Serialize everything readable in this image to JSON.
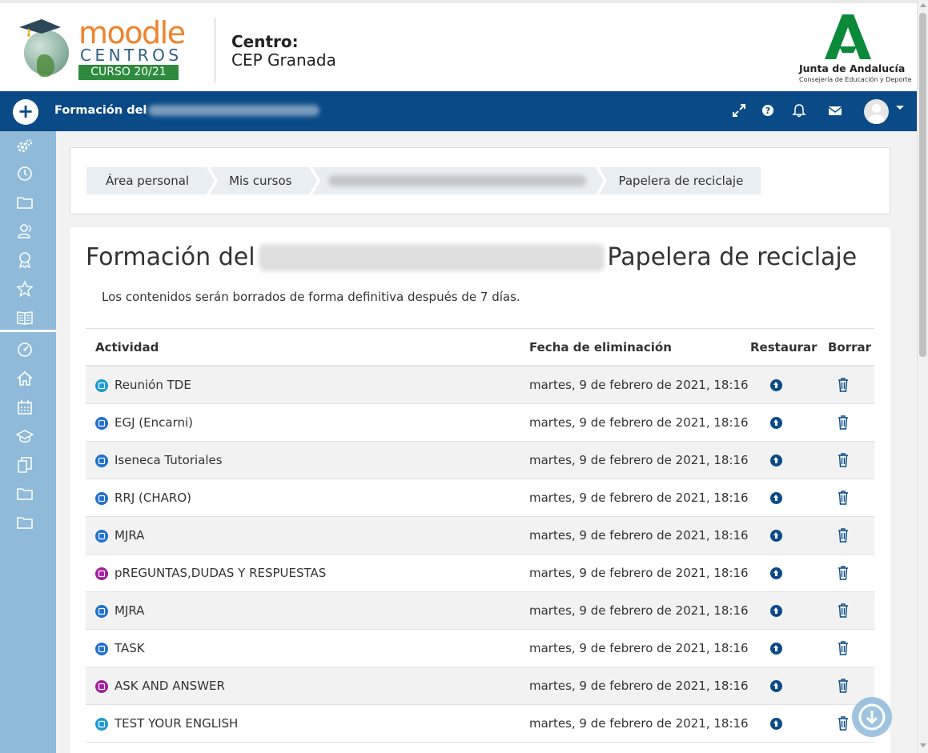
{
  "header": {
    "logo_moodle": "moodle",
    "logo_centros": "CENTROS",
    "logo_curso": "CURSO 20/21",
    "centro_label": "Centro:",
    "centro_name": "CEP Granada",
    "junta_name": "Junta de Andalucía",
    "junta_sub": "Consejería de Educación y Deporte"
  },
  "navbar": {
    "course_prefix": "Formación del",
    "icons": [
      "fullscreen-icon",
      "help-icon",
      "bell-icon",
      "envelope-icon"
    ]
  },
  "breadcrumb": {
    "items": [
      "Área personal",
      "Mis cursos",
      "",
      "Papelera de reciclaje"
    ]
  },
  "page": {
    "title_prefix": "Formación del",
    "title_suffix": "Papelera de reciclaje",
    "notice": "Los contenidos serán borrados de forma definitiva después de 7 días."
  },
  "table": {
    "headers": {
      "activity": "Actividad",
      "date": "Fecha de eliminación",
      "restore": "Restaurar",
      "delete": "Borrar"
    },
    "rows": [
      {
        "name": "Reunión TDE",
        "date": "martes, 9 de febrero de 2021, 18:16",
        "icon": "url-icon",
        "color": "#1b9bd1"
      },
      {
        "name": "EGJ (Encarni)",
        "date": "martes, 9 de febrero de 2021, 18:16",
        "icon": "file-icon",
        "color": "#1f6fd0"
      },
      {
        "name": "Iseneca Tutoriales",
        "date": "martes, 9 de febrero de 2021, 18:16",
        "icon": "page-icon",
        "color": "#1f6fd0"
      },
      {
        "name": "RRJ (CHARO)",
        "date": "martes, 9 de febrero de 2021, 18:16",
        "icon": "label-icon",
        "color": "#1f6fd0"
      },
      {
        "name": "MJRA",
        "date": "martes, 9 de febrero de 2021, 18:16",
        "icon": "label-icon",
        "color": "#1f6fd0"
      },
      {
        "name": "pREGUNTAS,DUDAS Y RESPUESTAS",
        "date": "martes, 9 de febrero de 2021, 18:16",
        "icon": "forum-icon",
        "color": "#a31e9e"
      },
      {
        "name": "MJRA",
        "date": "martes, 9 de febrero de 2021, 18:16",
        "icon": "page-icon",
        "color": "#1f6fd0"
      },
      {
        "name": "TASK",
        "date": "martes, 9 de febrero de 2021, 18:16",
        "icon": "assignment-icon",
        "color": "#1f6fd0"
      },
      {
        "name": "ASK AND ANSWER",
        "date": "martes, 9 de febrero de 2021, 18:16",
        "icon": "forum-icon",
        "color": "#a31e9e"
      },
      {
        "name": "TEST YOUR ENGLISH",
        "date": "martes, 9 de febrero de 2021, 18:16",
        "icon": "link-icon",
        "color": "#1b9bd1"
      }
    ]
  },
  "sidebar": {
    "icons": [
      "cogs-icon",
      "clock-icon",
      "folder-icon",
      "users-icon",
      "badge-icon",
      "star-icon",
      "book-icon",
      "dashboard-icon",
      "home-icon",
      "calendar-icon",
      "graduation-cap-icon",
      "files-icon",
      "folder-icon",
      "folder-icon"
    ]
  },
  "colors": {
    "navbar": "#0a4a87",
    "sidebar": "#8fbad9",
    "moodle_orange": "#f0832b",
    "curso_green": "#2e8b3e",
    "junta_green": "#0b8a3a"
  }
}
